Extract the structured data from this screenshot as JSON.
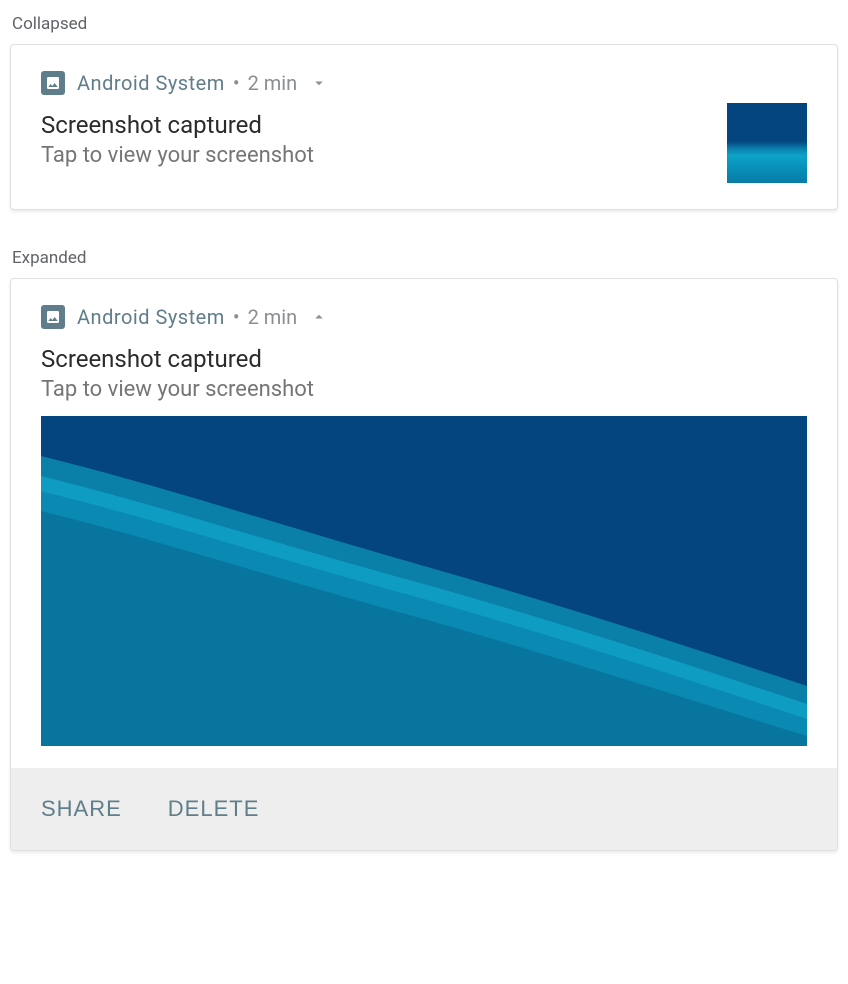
{
  "sections": {
    "collapsed_label": "Collapsed",
    "expanded_label": "Expanded"
  },
  "notification": {
    "app_name": "Android  System",
    "separator": "•",
    "time": "2 min",
    "title": "Screenshot captured",
    "subtitle": "Tap to view your screenshot"
  },
  "actions": {
    "share": "SHARE",
    "delete": "DELETE"
  }
}
